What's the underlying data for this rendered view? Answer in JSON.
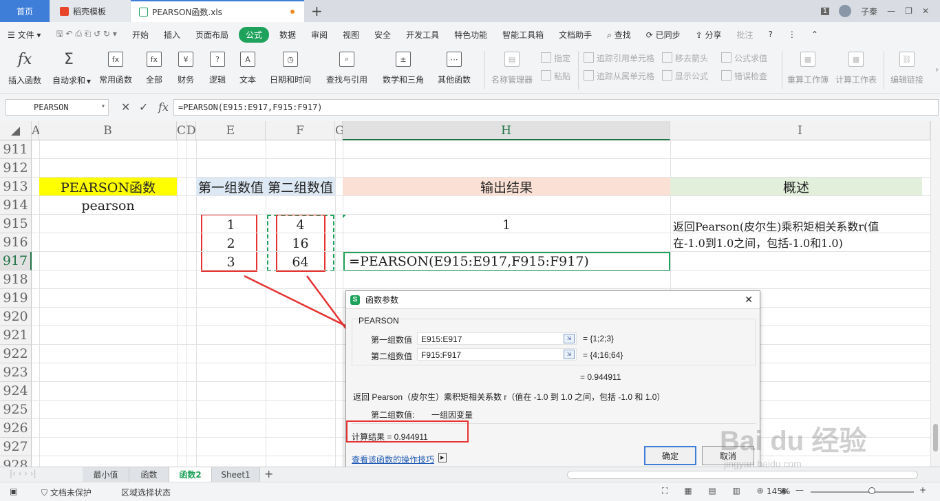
{
  "titlebar": {
    "tabs": [
      {
        "label": "首页"
      },
      {
        "label": "稻壳模板"
      },
      {
        "label": "PEARSON函数.xls"
      }
    ],
    "badge": "1",
    "user": "子秦"
  },
  "menu": {
    "items": [
      "文件",
      "开始",
      "插入",
      "页面布局",
      "公式",
      "数据",
      "审阅",
      "视图",
      "安全",
      "开发工具",
      "特色功能",
      "智能工具箱",
      "文档助手",
      "查找",
      "已同步",
      "分享",
      "批注"
    ]
  },
  "ribbon": {
    "buttons": [
      "插入函数",
      "自动求和",
      "常用函数",
      "全部",
      "财务",
      "逻辑",
      "文本",
      "日期和时间",
      "查找与引用",
      "数学和三角",
      "其他函数",
      "名称管理器",
      "重算工作簿",
      "计算工作表",
      "编辑链接"
    ],
    "small": [
      "指定",
      "粘贴",
      "追踪引用单元格",
      "移去箭头",
      "公式求值",
      "追踪从属单元格",
      "显示公式",
      "错误检查"
    ]
  },
  "formula_bar": {
    "name_box": "PEARSON",
    "formula": "=PEARSON(E915:E917,F915:F917)"
  },
  "columns": [
    "A",
    "B",
    "C",
    "D",
    "E",
    "F",
    "G",
    "H",
    "I"
  ],
  "rows": [
    "911",
    "912",
    "913",
    "914",
    "915",
    "916",
    "917",
    "918",
    "919",
    "920",
    "921",
    "922",
    "923",
    "924",
    "925",
    "926",
    "927",
    "928"
  ],
  "cells": {
    "b913": "PEARSON函数",
    "b914": "pearson",
    "e913": "第一组数值",
    "f913": "第二组数值",
    "h913": "输出结果",
    "i913": "概述",
    "e915": "1",
    "e916": "2",
    "e917": "3",
    "f915": "4",
    "f916": "16",
    "f917": "64",
    "h915": "1",
    "h917": "=PEARSON(E915:E917,F915:F917)",
    "i915": "返回Pearson(皮尔生)乘积矩相关系数r(值",
    "i916": "在-1.0到1.0之间，包括-1.0和1.0)"
  },
  "colors": {
    "yellow": "#ffff00",
    "lightblue": "#dce9f5",
    "peach": "#fbe1d5",
    "lightgreen": "#e2efda",
    "accent": "#1fa35c",
    "annotation": "#e63232"
  },
  "dialog": {
    "title": "函数参数",
    "func": "PEARSON",
    "arg1_label": "第一组数值",
    "arg1_value": "E915:E917",
    "arg1_result": "= {1;2;3}",
    "arg2_label": "第二组数值",
    "arg2_value": "F915:F917",
    "arg2_result": "= {4;16;64}",
    "result_line": "=  0.944911",
    "description": "返回 Pearson（皮尔生）乘积矩相关系数 r（值在 -1.0 到 1.0 之间，包括 -1.0 和 1.0）",
    "param_name": "第二组数值:",
    "param_desc": "一组因变量",
    "calc_result": "计算结果  =  0.944911",
    "link": "查看该函数的操作技巧",
    "ok": "确定",
    "cancel": "取消"
  },
  "sheets": [
    "最小值",
    "函数",
    "函数2",
    "Sheet1"
  ],
  "active_sheet": "函数2",
  "status": {
    "protect": "文档未保护",
    "mode": "区域选择状态",
    "zoom": "145%"
  },
  "watermark": {
    "brand": "Bai du 经验",
    "url": "jingyan.baidu.com"
  }
}
